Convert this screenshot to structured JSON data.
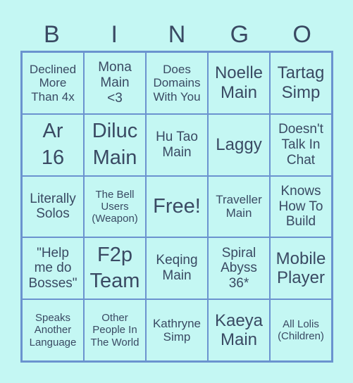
{
  "header": {
    "letters": [
      "B",
      "I",
      "N",
      "G",
      "O"
    ]
  },
  "card": {
    "cells": [
      {
        "text": "Declined\nMore\nThan 4x",
        "size": "s2"
      },
      {
        "text": "Mona\nMain\n<3",
        "size": "s3"
      },
      {
        "text": "Does\nDomains\nWith You",
        "size": "s2"
      },
      {
        "text": "Noelle\nMain",
        "size": "s4"
      },
      {
        "text": "Tartag\nSimp",
        "size": "s4"
      },
      {
        "text": "Ar\n16",
        "size": "s5"
      },
      {
        "text": "Diluc\nMain",
        "size": "s5"
      },
      {
        "text": "Hu Tao\nMain",
        "size": "s3"
      },
      {
        "text": "Laggy",
        "size": "s4"
      },
      {
        "text": "Doesn't\nTalk In\nChat",
        "size": "s3"
      },
      {
        "text": "Literally\nSolos",
        "size": "s3"
      },
      {
        "text": "The Bell\nUsers\n(Weapon)",
        "size": "s1"
      },
      {
        "text": "Free!",
        "size": "s5"
      },
      {
        "text": "Traveller\nMain",
        "size": "s2"
      },
      {
        "text": "Knows\nHow To\nBuild",
        "size": "s3"
      },
      {
        "text": "\"Help\nme do\nBosses\"",
        "size": "s3"
      },
      {
        "text": "F2p\nTeam",
        "size": "s5"
      },
      {
        "text": "Keqing\nMain",
        "size": "s3"
      },
      {
        "text": "Spiral\nAbyss\n36*",
        "size": "s3"
      },
      {
        "text": "Mobile\nPlayer",
        "size": "s4"
      },
      {
        "text": "Speaks\nAnother\nLanguage",
        "size": "s1"
      },
      {
        "text": "Other\nPeople In\nThe World",
        "size": "s1"
      },
      {
        "text": "Kathryne\nSimp",
        "size": "s2"
      },
      {
        "text": "Kaeya\nMain",
        "size": "s4"
      },
      {
        "text": "All Lolis\n(Children)",
        "size": "s1"
      }
    ]
  }
}
